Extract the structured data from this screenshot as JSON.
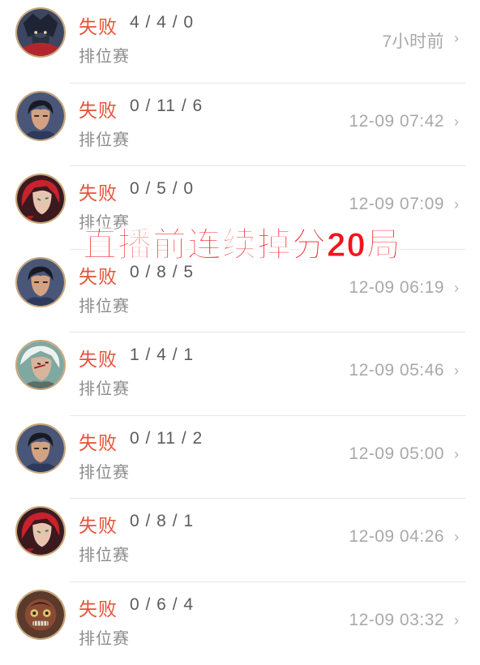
{
  "matches": [
    {
      "result": "失败",
      "kda": "4 / 4 / 0",
      "mode": "排位赛",
      "time": "7小时前",
      "hero_icon": "dark-armored-hero-avatar-icon"
    },
    {
      "result": "失败",
      "kda": "0 / 11 / 6",
      "mode": "排位赛",
      "time": "12-09 07:42",
      "hero_icon": "dark-haired-swordsman-avatar-icon"
    },
    {
      "result": "失败",
      "kda": "0 / 5 / 0",
      "mode": "排位赛",
      "time": "12-09 07:09",
      "hero_icon": "red-haired-assassin-avatar-icon"
    },
    {
      "result": "失败",
      "kda": "0 / 8 / 5",
      "mode": "排位赛",
      "time": "12-09 06:19",
      "hero_icon": "dark-haired-swordsman-avatar-icon"
    },
    {
      "result": "失败",
      "kda": "1 / 4 / 1",
      "mode": "排位赛",
      "time": "12-09 05:46",
      "hero_icon": "white-haired-warrior-avatar-icon"
    },
    {
      "result": "失败",
      "kda": "0 / 11 / 2",
      "mode": "排位赛",
      "time": "12-09 05:00",
      "hero_icon": "dark-haired-swordsman-avatar-icon"
    },
    {
      "result": "失败",
      "kda": "0 / 8 / 1",
      "mode": "排位赛",
      "time": "12-09 04:26",
      "hero_icon": "red-haired-assassin-avatar-icon"
    },
    {
      "result": "失败",
      "kda": "0 / 6 / 4",
      "mode": "排位赛",
      "time": "12-09 03:32",
      "hero_icon": "masked-mechanic-avatar-icon"
    }
  ],
  "overlay_caption": "直播前连续掉分20局",
  "colors": {
    "loss_text": "#e4523a",
    "overlay_text": "#f2141c",
    "avatar_ring": "#c8a679"
  }
}
